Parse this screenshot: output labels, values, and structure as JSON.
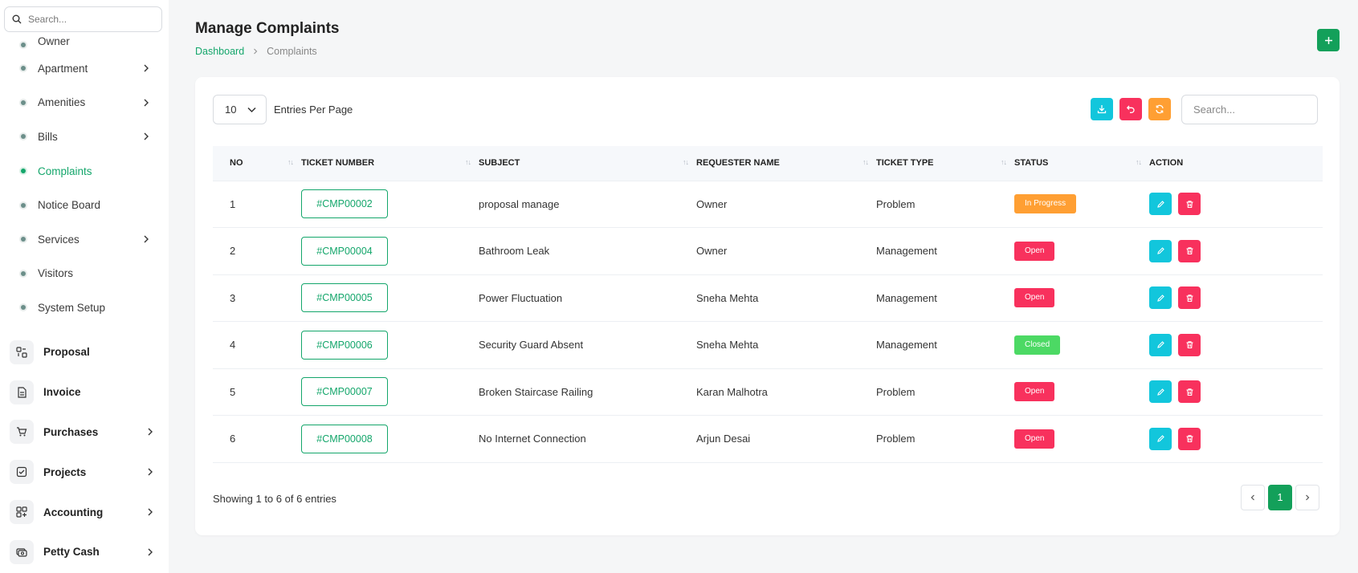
{
  "sidebar": {
    "search_placeholder": "Search...",
    "sub_items": [
      {
        "label": "Owner",
        "chevron": false,
        "active": false
      },
      {
        "label": "Apartment",
        "chevron": true,
        "active": false
      },
      {
        "label": "Amenities",
        "chevron": true,
        "active": false
      },
      {
        "label": "Bills",
        "chevron": true,
        "active": false
      },
      {
        "label": "Complaints",
        "chevron": false,
        "active": true
      },
      {
        "label": "Notice Board",
        "chevron": false,
        "active": false
      },
      {
        "label": "Services",
        "chevron": true,
        "active": false
      },
      {
        "label": "Visitors",
        "chevron": false,
        "active": false
      },
      {
        "label": "System Setup",
        "chevron": false,
        "active": false
      }
    ],
    "main_items": [
      {
        "label": "Proposal",
        "icon": "proposal-icon",
        "chevron": false
      },
      {
        "label": "Invoice",
        "icon": "invoice-icon",
        "chevron": false
      },
      {
        "label": "Purchases",
        "icon": "cart-icon",
        "chevron": true
      },
      {
        "label": "Projects",
        "icon": "checkbox-icon",
        "chevron": true
      },
      {
        "label": "Accounting",
        "icon": "accounting-icon",
        "chevron": true
      },
      {
        "label": "Petty Cash",
        "icon": "cash-icon",
        "chevron": true
      }
    ]
  },
  "header": {
    "title": "Manage Complaints",
    "breadcrumb": {
      "home": "Dashboard",
      "current": "Complaints"
    },
    "add_icon": "plus-icon"
  },
  "toolbar": {
    "entries_value": "10",
    "entries_label": "Entries Per Page",
    "search_placeholder": "Search...",
    "buttons": [
      "download-icon",
      "undo-icon",
      "refresh-icon"
    ]
  },
  "table": {
    "columns": [
      "NO",
      "TICKET NUMBER",
      "SUBJECT",
      "REQUESTER NAME",
      "TICKET TYPE",
      "STATUS",
      "ACTION"
    ],
    "rows": [
      {
        "no": "1",
        "ticket": "#CMP00002",
        "subject": "proposal manage",
        "requester": "Owner",
        "type": "Problem",
        "status": "In Progress",
        "status_kind": "progress"
      },
      {
        "no": "2",
        "ticket": "#CMP00004",
        "subject": "Bathroom Leak",
        "requester": "Owner",
        "type": "Management",
        "status": "Open",
        "status_kind": "open"
      },
      {
        "no": "3",
        "ticket": "#CMP00005",
        "subject": "Power Fluctuation",
        "requester": "Sneha Mehta",
        "type": "Management",
        "status": "Open",
        "status_kind": "open"
      },
      {
        "no": "4",
        "ticket": "#CMP00006",
        "subject": "Security Guard Absent",
        "requester": "Sneha Mehta",
        "type": "Management",
        "status": "Closed",
        "status_kind": "closed"
      },
      {
        "no": "5",
        "ticket": "#CMP00007",
        "subject": "Broken Staircase Railing",
        "requester": "Karan Malhotra",
        "type": "Problem",
        "status": "Open",
        "status_kind": "open"
      },
      {
        "no": "6",
        "ticket": "#CMP00008",
        "subject": "No Internet Connection",
        "requester": "Arjun Desai",
        "type": "Problem",
        "status": "Open",
        "status_kind": "open"
      }
    ]
  },
  "footer": {
    "showing": "Showing 1 to 6 of 6 entries",
    "current_page": "1"
  },
  "colors": {
    "brand": "#13a05a",
    "cyan": "#12c6dc",
    "pink": "#f8315d",
    "orange": "#ff9f33",
    "green": "#4cd964"
  }
}
